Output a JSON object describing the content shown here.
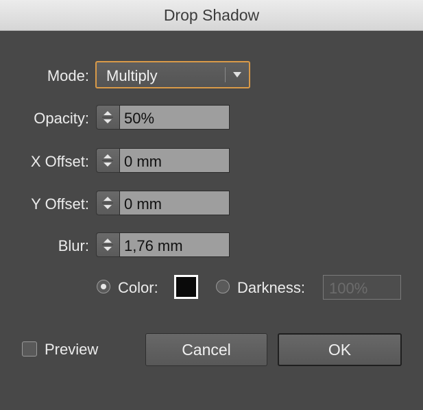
{
  "window": {
    "title": "Drop Shadow"
  },
  "mode": {
    "label": "Mode:",
    "value": "Multiply"
  },
  "opacity": {
    "label": "Opacity:",
    "value": "50%"
  },
  "x_offset": {
    "label": "X Offset:",
    "value": "0 mm"
  },
  "y_offset": {
    "label": "Y Offset:",
    "value": "0 mm"
  },
  "blur": {
    "label": "Blur:",
    "value": "1,76 mm"
  },
  "color_option": {
    "label": "Color:",
    "selected": true,
    "swatch_color": "#0a0a0a"
  },
  "darkness_option": {
    "label": "Darkness:",
    "selected": false,
    "value": "100%"
  },
  "preview": {
    "label": "Preview",
    "checked": false
  },
  "buttons": {
    "cancel": "Cancel",
    "ok": "OK"
  },
  "colors": {
    "accent": "#d99a48",
    "background": "#484848",
    "field": "#9e9e9e"
  }
}
